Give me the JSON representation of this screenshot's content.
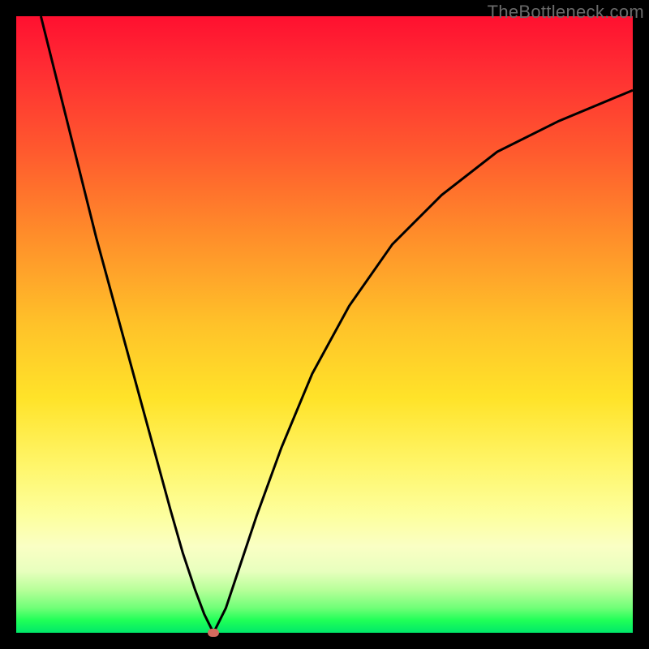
{
  "watermark": "TheBottleneck.com",
  "colors": {
    "top": "#ff1030",
    "mid": "#ffe329",
    "bottom": "#00e86a",
    "curve": "#000000",
    "marker": "#d46a5e",
    "frame_bg": "#000000"
  },
  "chart_data": {
    "type": "line",
    "title": "",
    "xlabel": "",
    "ylabel": "",
    "xlim": [
      0,
      100
    ],
    "ylim": [
      0,
      100
    ],
    "grid": false,
    "annotations": [
      "TheBottleneck.com"
    ],
    "series": [
      {
        "name": "bottleneck-curve",
        "x": [
          4,
          7,
          10,
          13,
          16,
          19,
          22,
          25,
          27,
          29,
          30.5,
          31.5,
          32,
          32.5,
          34,
          36,
          39,
          43,
          48,
          54,
          61,
          69,
          78,
          88,
          100
        ],
        "y": [
          100,
          88,
          76,
          64,
          53,
          42,
          31,
          20,
          13,
          7,
          3,
          1,
          0,
          1,
          4,
          10,
          19,
          30,
          42,
          53,
          63,
          71,
          78,
          83,
          88
        ]
      }
    ],
    "marker": {
      "x": 32,
      "y": 0,
      "name": "bottleneck-minimum"
    }
  }
}
